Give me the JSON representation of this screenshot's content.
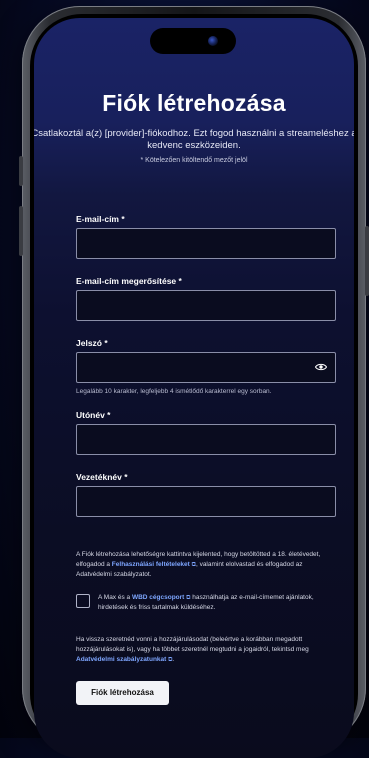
{
  "page": {
    "title": "Fiók létrehozása",
    "subtitle_line1": "Csatlakoztál a(z) [provider]-fiókodhoz. Ezt fogod használni a streameléshez a",
    "subtitle_line2": "kedvenc eszközeiden.",
    "required_note": "* Kötelezően kitöltendő mezőt jelöl"
  },
  "form": {
    "email": {
      "label": "E-mail-cím *",
      "value": "",
      "placeholder": ""
    },
    "email_confirm": {
      "label": "E-mail-cím megerősítése *",
      "value": "",
      "placeholder": ""
    },
    "password": {
      "label": "Jelszó *",
      "value": "",
      "placeholder": "",
      "hint": "Legalább 10 karakter, legfeljebb 4 ismétlődő karakterrel egy sorban."
    },
    "first_name": {
      "label": "Utónév *",
      "value": "",
      "placeholder": ""
    },
    "last_name": {
      "label": "Vezetéknév *",
      "value": "",
      "placeholder": ""
    }
  },
  "legal": {
    "terms_p1": "A Fiók létrehozása lehetőségre kattintva kijelented, hogy betöltötted a 18. életévedet, elfogadod a",
    "terms_link": "Felhasználási feltételeket",
    "terms_p2": ", valamint elolvastad és elfogadod az Adatvédelmi szabályzatot.",
    "consent_p1": "A Max és a",
    "consent_link": "WBD cégcsoport",
    "consent_p2": "használhatja az e-mail-címemet ajánlatok, hirdetések és friss tartalmak küldéséhez.",
    "consent_checked": false,
    "withdraw_p1": "Ha vissza szeretnéd vonni a hozzájárulásodat (beleértve a korábban megadott hozzájárulásokat is), vagy ha többet szeretnél megtudni a jogaidról, tekintsd meg",
    "withdraw_link": "Adatvédelmi szabályzatunkat",
    "withdraw_p2": "."
  },
  "actions": {
    "submit_label": "Fiók létrehozása"
  },
  "icons": {
    "password_toggle": "eye-icon",
    "external_link": "external-link-icon"
  },
  "colors": {
    "link": "#7ea6ff",
    "button_bg": "#f2f3f7",
    "header_bg": "#1a2366"
  }
}
